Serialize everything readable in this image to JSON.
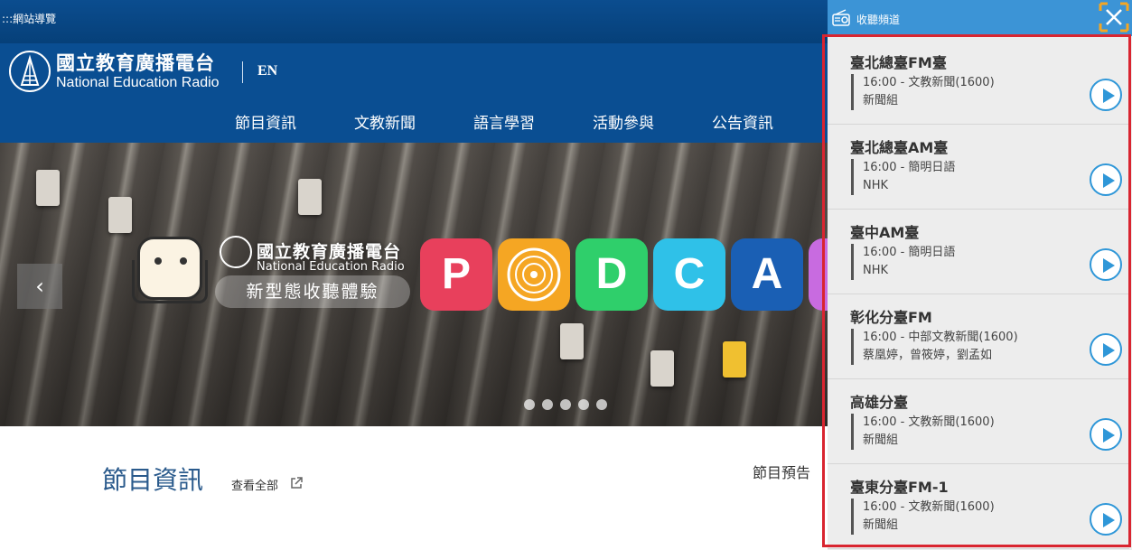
{
  "topbar": {
    "sitemap": ":::網站導覽"
  },
  "header": {
    "logo_cn": "國立教育廣播電台",
    "logo_en": "National Education Radio",
    "lang": "EN",
    "nav": [
      "節目資訊",
      "文教新聞",
      "語言學習",
      "活動參與",
      "公告資訊"
    ]
  },
  "banner": {
    "logo_cn": "國立教育廣播電台",
    "logo_en": "National Education Radio",
    "slogan": "新型態收聽體驗",
    "tiles": [
      {
        "letter": "P",
        "color": "#e8405c"
      },
      {
        "letter": "",
        "color": "#f5a623"
      },
      {
        "letter": "D",
        "color": "#2fcf6b"
      },
      {
        "letter": "C",
        "color": "#2fc1e8"
      },
      {
        "letter": "A",
        "color": "#1a5fb4"
      }
    ],
    "prev_icon": "‹"
  },
  "content": {
    "title": "節目資訊",
    "view_all": "查看全部",
    "preview": "節目預告"
  },
  "panel": {
    "title": "收聽頻道",
    "channels": [
      {
        "name": "臺北總臺FM臺",
        "program": "16:00 - 文教新聞(1600)",
        "host": "新聞組"
      },
      {
        "name": "臺北總臺AM臺",
        "program": "16:00 - 簡明日語",
        "host": "NHK"
      },
      {
        "name": "臺中AM臺",
        "program": "16:00 - 簡明日語",
        "host": "NHK"
      },
      {
        "name": "彰化分臺FM",
        "program": "16:00 - 中部文教新聞(1600)",
        "host": "蔡凰婷，曾筱婷，劉孟如"
      },
      {
        "name": "高雄分臺",
        "program": "16:00 - 文教新聞(1600)",
        "host": "新聞組"
      },
      {
        "name": "臺東分臺FM-1",
        "program": "16:00 - 文教新聞(1600)",
        "host": "新聞組"
      }
    ]
  },
  "colors": {
    "header": "#0a4e92",
    "panel_head": "#3c94d6",
    "play": "#2f97d8",
    "highlight": "#d92530"
  }
}
